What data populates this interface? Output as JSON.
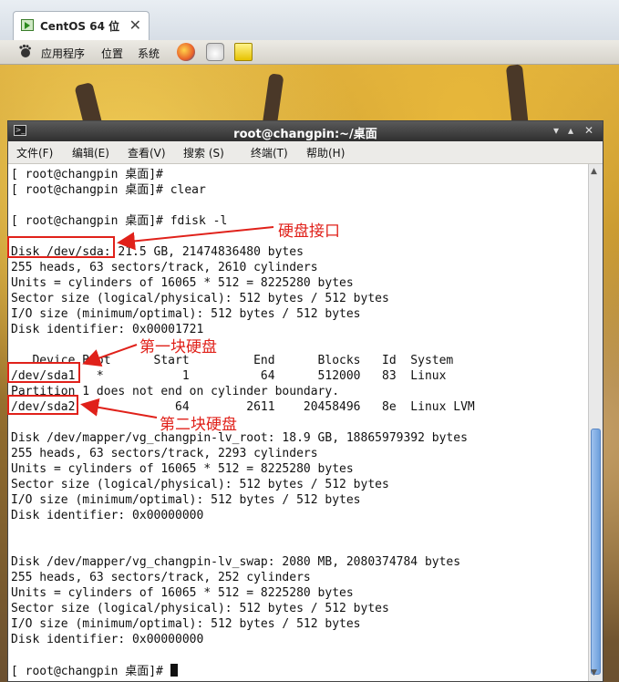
{
  "vm_tab": {
    "title": "CentOS 64 位",
    "close": "✕"
  },
  "panel": {
    "applications": "应用程序",
    "places": "位置",
    "system": "系统"
  },
  "terminal": {
    "title": "root@changpin:~/桌面",
    "menu": [
      "文件(F)",
      "编辑(E)",
      "查看(V)",
      "搜索 (S)",
      "终端(T)",
      "帮助(H)"
    ],
    "lines": [
      "[ root@changpin 桌面]#",
      "[ root@changpin 桌面]# clear",
      "",
      "[ root@changpin 桌面]# fdisk -l",
      "",
      "Disk /dev/sda: 21.5 GB, 21474836480 bytes",
      "255 heads, 63 sectors/track, 2610 cylinders",
      "Units = cylinders of 16065 * 512 = 8225280 bytes",
      "Sector size (logical/physical): 512 bytes / 512 bytes",
      "I/O size (minimum/optimal): 512 bytes / 512 bytes",
      "Disk identifier: 0x00001721",
      "",
      "   Device Boot      Start         End      Blocks   Id  System",
      "/dev/sda1   *           1          64      512000   83  Linux",
      "Partition 1 does not end on cylinder boundary.",
      "/dev/sda2              64        2611    20458496   8e  Linux LVM",
      "",
      "Disk /dev/mapper/vg_changpin-lv_root: 18.9 GB, 18865979392 bytes",
      "255 heads, 63 sectors/track, 2293 cylinders",
      "Units = cylinders of 16065 * 512 = 8225280 bytes",
      "Sector size (logical/physical): 512 bytes / 512 bytes",
      "I/O size (minimum/optimal): 512 bytes / 512 bytes",
      "Disk identifier: 0x00000000",
      "",
      "",
      "Disk /dev/mapper/vg_changpin-lv_swap: 2080 MB, 2080374784 bytes",
      "255 heads, 63 sectors/track, 252 cylinders",
      "Units = cylinders of 16065 * 512 = 8225280 bytes",
      "Sector size (logical/physical): 512 bytes / 512 bytes",
      "I/O size (minimum/optimal): 512 bytes / 512 bytes",
      "Disk identifier: 0x00000000",
      "",
      "[ root@changpin 桌面]# "
    ]
  },
  "annotations": {
    "disk_interface": "硬盘接口",
    "first_disk": "第一块硬盘",
    "second_disk": "第二块硬盘"
  },
  "colors": {
    "annotation": "#e0211a",
    "terminal_bg": "#ffffff",
    "titlebar": "#3a3a3a"
  }
}
